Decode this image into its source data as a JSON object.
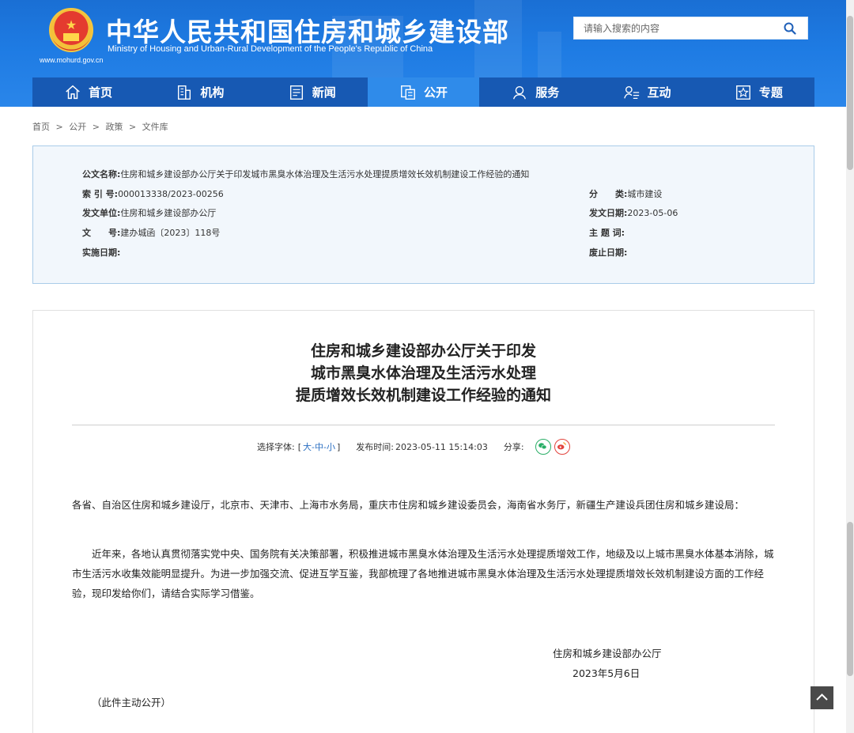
{
  "header": {
    "title_cn": "中华人民共和国住房和城乡建设部",
    "title_en": "Ministry of Housing and Urban-Rural Development of the People's Republic of China",
    "site_url": "www.mohurd.gov.cn",
    "search_placeholder": "请输入搜索的内容"
  },
  "nav": [
    {
      "label": "首页",
      "icon": "home-icon"
    },
    {
      "label": "机构",
      "icon": "building-icon"
    },
    {
      "label": "新闻",
      "icon": "news-icon"
    },
    {
      "label": "公开",
      "icon": "document-icon",
      "active": true
    },
    {
      "label": "服务",
      "icon": "service-icon"
    },
    {
      "label": "互动",
      "icon": "interact-icon"
    },
    {
      "label": "专题",
      "icon": "topic-star-icon"
    }
  ],
  "breadcrumb": [
    "首页",
    "公开",
    "政策",
    "文件库"
  ],
  "breadcrumb_sep": ">",
  "meta": {
    "doc_name_key": "公文名称:",
    "doc_name": "住房和城乡建设部办公厅关于印发城市黑臭水体治理及生活污水处理提质增效长效机制建设工作经验的通知",
    "index_key": "索 引 号:",
    "index": "000013338/2023-00256",
    "category_key": "分　　类:",
    "category": "城市建设",
    "issuer_key": "发文单位:",
    "issuer": "住房和城乡建设部办公厅",
    "issue_date_key": "发文日期:",
    "issue_date": "2023-05-06",
    "doc_no_key": "文　　号:",
    "doc_no": "建办城函〔2023〕118号",
    "subject_key": "主 题 词:",
    "subject": "",
    "effective_key": "实施日期:",
    "effective": "",
    "expire_key": "废止日期:",
    "expire": ""
  },
  "article": {
    "title_line1": "住房和城乡建设部办公厅关于印发",
    "title_line2": "城市黑臭水体治理及生活污水处理",
    "title_line3": "提质增效长效机制建设工作经验的通知",
    "font_select_label": "选择字体:",
    "font_bracket_open": "[",
    "font_large": "大",
    "font_medium": "中",
    "font_small": "小",
    "font_bracket_close": "]",
    "font_sep": "-",
    "publish_label": "发布时间:",
    "publish_time": "2023-05-11 15:14:03",
    "share_label": "分享:",
    "addressee": "各省、自治区住房和城乡建设厅，北京市、天津市、上海市水务局，重庆市住房和城乡建设委员会，海南省水务厅，新疆生产建设兵团住房和城乡建设局：",
    "body": "近年来，各地认真贯彻落实党中央、国务院有关决策部署，积极推进城市黑臭水体治理及生活污水处理提质增效工作，地级及以上城市黑臭水体基本消除，城市生活污水收集效能明显提升。为进一步加强交流、促进互学互鉴，我部梳理了各地推进城市黑臭水体治理及生活污水处理提质增效长效机制建设方面的工作经验，现印发给你们，请结合实际学习借鉴。",
    "signature": "住房和城乡建设部办公厅",
    "date": "2023年5月6日",
    "note": "（此件主动公开）"
  },
  "colors": {
    "header_blue": "#1e7be3",
    "nav_dark": "#1759b3",
    "nav_active": "#2f8bea",
    "link_blue": "#2b6fc2"
  }
}
